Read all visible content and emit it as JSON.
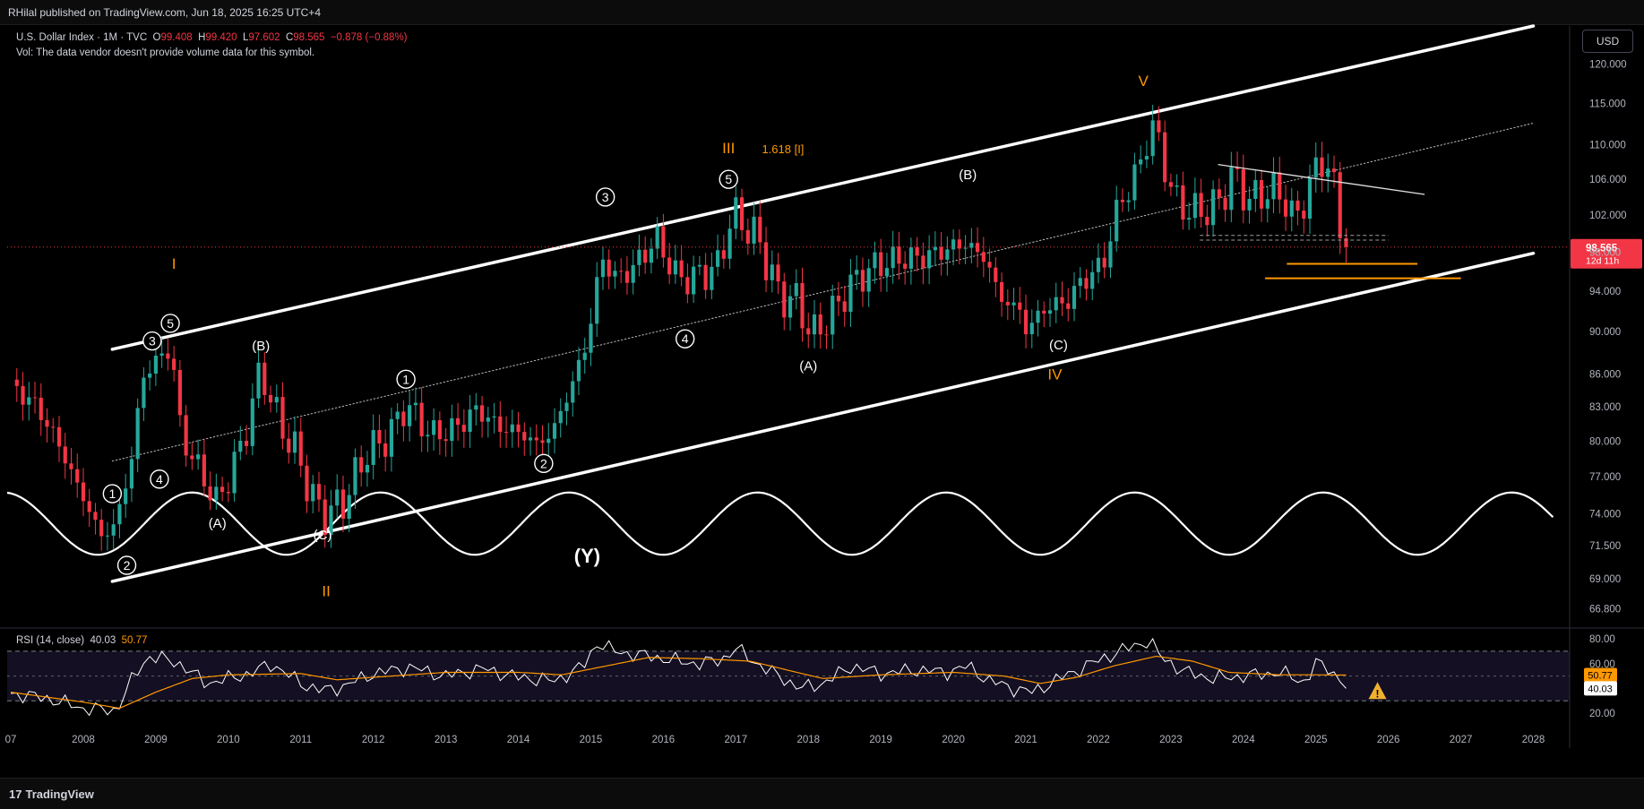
{
  "header": {
    "publisher_line": "RHilal published on TradingView.com, Jun 18, 2025 16:25 UTC+4"
  },
  "legend": {
    "symbol": "U.S. Dollar Index · 1M · TVC",
    "open_label": "O",
    "open": "99.408",
    "high_label": "H",
    "high": "99.420",
    "low_label": "L",
    "low": "97.602",
    "close_label": "C",
    "close": "98.565",
    "change": "−0.878 (−0.88%)",
    "volume_note": "Vol: The data vendor doesn't provide volume data for this symbol."
  },
  "currency_button": "USD",
  "footer": {
    "brand": "TradingView",
    "logo_text": "17"
  },
  "colors": {
    "up": "#26a69a",
    "down": "#f23645",
    "channel": "#ffffff",
    "wave_orange": "#ff9800",
    "rsi_line": "#ffffff",
    "rsi_ma": "#ff9800",
    "price_line": "#f23645"
  },
  "chart_data": [
    {
      "type": "candlestick",
      "title": "U.S. Dollar Index · 1M · TVC",
      "y_scale": "log",
      "ylim": [
        65.5,
        125
      ],
      "x_range": [
        2006.95,
        2028.5
      ],
      "x_ticks": [
        "07",
        "2008",
        "2009",
        "2010",
        "2011",
        "2012",
        "2013",
        "2014",
        "2015",
        "2016",
        "2017",
        "2018",
        "2019",
        "2020",
        "2021",
        "2022",
        "2023",
        "2024",
        "2025",
        "2026",
        "2027",
        "2028"
      ],
      "y_ticks": [
        "120.000",
        "115.000",
        "110.000",
        "106.000",
        "102.000",
        "98.000",
        "94.000",
        "90.000",
        "86.000",
        "83.000",
        "80.000",
        "77.000",
        "74.000",
        "71.500",
        "69.000",
        "66.800"
      ],
      "last_price": {
        "value": 98.565,
        "label": "98.565",
        "countdown": "12d 11h"
      },
      "channel": {
        "upper": [
          [
            2008.4,
            88.3
          ],
          [
            2028.0,
            125.0
          ]
        ],
        "middle": [
          [
            2008.4,
            78.3
          ],
          [
            2028.0,
            112.6
          ]
        ],
        "lower": [
          [
            2008.4,
            68.8
          ],
          [
            2028.0,
            97.9
          ]
        ]
      },
      "cycle": {
        "high": 75.7,
        "low": 70.8,
        "first_trough": 2008.2,
        "period": 2.6
      },
      "support_lines": [
        {
          "x": [
            2024.6,
            2026.4
          ],
          "y": 96.8
        },
        {
          "x": [
            2024.3,
            2027.0
          ],
          "y": 95.3
        }
      ],
      "dashed_levels": [
        {
          "x": [
            2023.4,
            2026.0
          ],
          "y": 99.8
        },
        {
          "x": [
            2023.4,
            2026.0
          ],
          "y": 99.3
        }
      ],
      "triangle_line": {
        "x": [
          2023.65,
          2026.5
        ],
        "y": [
          107.7,
          104.3
        ]
      },
      "wave_labels": [
        {
          "text": "I",
          "x": 2009.25,
          "y": 96.3,
          "style": "orange"
        },
        {
          "text": "II",
          "x": 2011.35,
          "y": 67.7,
          "style": "orange"
        },
        {
          "text": "III",
          "x": 2016.9,
          "y": 109.0,
          "style": "orange"
        },
        {
          "text": "1.618 [I]",
          "x": 2017.65,
          "y": 109.0,
          "style": "orange-small"
        },
        {
          "text": "IV",
          "x": 2021.4,
          "y": 85.5,
          "style": "orange"
        },
        {
          "text": "V",
          "x": 2022.62,
          "y": 117.2,
          "style": "orange"
        },
        {
          "text": "1",
          "x": 2008.4,
          "y": 75.6,
          "style": "circle"
        },
        {
          "text": "2",
          "x": 2008.6,
          "y": 70.0,
          "style": "circle"
        },
        {
          "text": "3",
          "x": 2008.95,
          "y": 89.1,
          "style": "circle"
        },
        {
          "text": "4",
          "x": 2009.05,
          "y": 76.8,
          "style": "circle"
        },
        {
          "text": "5",
          "x": 2009.2,
          "y": 90.8,
          "style": "circle"
        },
        {
          "text": "(A)",
          "x": 2009.85,
          "y": 72.9,
          "style": "white"
        },
        {
          "text": "(B)",
          "x": 2010.45,
          "y": 88.2,
          "style": "white"
        },
        {
          "text": "(C)",
          "x": 2011.3,
          "y": 72.0,
          "style": "white"
        },
        {
          "text": "1",
          "x": 2012.45,
          "y": 85.5,
          "style": "circle"
        },
        {
          "text": "2",
          "x": 2014.35,
          "y": 78.1,
          "style": "circle"
        },
        {
          "text": "3",
          "x": 2015.2,
          "y": 104.0,
          "style": "circle"
        },
        {
          "text": "4",
          "x": 2016.3,
          "y": 89.3,
          "style": "circle"
        },
        {
          "text": "5",
          "x": 2016.9,
          "y": 106.0,
          "style": "circle"
        },
        {
          "text": "(Y)",
          "x": 2014.95,
          "y": 70.2,
          "style": "white-big"
        },
        {
          "text": "(A)",
          "x": 2018.0,
          "y": 86.3,
          "style": "white"
        },
        {
          "text": "(B)",
          "x": 2020.2,
          "y": 106.0,
          "style": "white"
        },
        {
          "text": "(C)",
          "x": 2021.45,
          "y": 88.3,
          "style": "white"
        }
      ]
    },
    {
      "type": "line",
      "title": "RSI (14, close)",
      "values_label": [
        "40.03",
        "50.77"
      ],
      "ylim": [
        10,
        88
      ],
      "y_ticks": [
        "80.00",
        "60.00",
        "20.00"
      ],
      "bands": [
        70,
        30
      ],
      "midline": 50,
      "rsi_last": {
        "value": 40.03,
        "label": "40.03"
      },
      "ma_last": {
        "value": 50.77,
        "label": "50.77"
      },
      "rsi_anchors": [
        [
          2007.0,
          36
        ],
        [
          2007.5,
          32
        ],
        [
          2008.0,
          24
        ],
        [
          2008.45,
          22
        ],
        [
          2008.7,
          50
        ],
        [
          2008.9,
          66
        ],
        [
          2009.3,
          61
        ],
        [
          2009.7,
          44
        ],
        [
          2010.3,
          52
        ],
        [
          2010.6,
          60
        ],
        [
          2011.0,
          44
        ],
        [
          2011.3,
          38
        ],
        [
          2011.6,
          42
        ],
        [
          2012.0,
          52
        ],
        [
          2012.5,
          57
        ],
        [
          2013.0,
          50
        ],
        [
          2013.5,
          56
        ],
        [
          2014.0,
          49
        ],
        [
          2014.5,
          46
        ],
        [
          2014.9,
          58
        ],
        [
          2015.1,
          78
        ],
        [
          2015.3,
          70
        ],
        [
          2015.8,
          66
        ],
        [
          2016.2,
          62
        ],
        [
          2016.5,
          60
        ],
        [
          2016.8,
          63
        ],
        [
          2017.0,
          72
        ],
        [
          2017.4,
          56
        ],
        [
          2017.9,
          40
        ],
        [
          2018.2,
          44
        ],
        [
          2018.6,
          58
        ],
        [
          2019.0,
          52
        ],
        [
          2019.5,
          55
        ],
        [
          2019.9,
          53
        ],
        [
          2020.2,
          58
        ],
        [
          2020.5,
          46
        ],
        [
          2020.9,
          39
        ],
        [
          2021.1,
          37
        ],
        [
          2021.5,
          49
        ],
        [
          2021.9,
          60
        ],
        [
          2022.3,
          70
        ],
        [
          2022.7,
          79
        ],
        [
          2022.85,
          66
        ],
        [
          2023.2,
          53
        ],
        [
          2023.6,
          48
        ],
        [
          2024.0,
          50
        ],
        [
          2024.5,
          53
        ],
        [
          2024.85,
          45
        ],
        [
          2025.0,
          60
        ],
        [
          2025.2,
          56
        ],
        [
          2025.4,
          40.03
        ]
      ],
      "ma_anchors": [
        [
          2007.0,
          37
        ],
        [
          2008.0,
          29
        ],
        [
          2008.5,
          24
        ],
        [
          2009.0,
          37
        ],
        [
          2009.5,
          48
        ],
        [
          2010.0,
          51
        ],
        [
          2011.0,
          52
        ],
        [
          2011.5,
          47
        ],
        [
          2012.0,
          49
        ],
        [
          2013.0,
          53
        ],
        [
          2014.0,
          53
        ],
        [
          2014.6,
          51
        ],
        [
          2015.2,
          58
        ],
        [
          2015.8,
          65
        ],
        [
          2016.5,
          64
        ],
        [
          2017.2,
          62
        ],
        [
          2017.7,
          55
        ],
        [
          2018.2,
          48
        ],
        [
          2019.0,
          51
        ],
        [
          2020.0,
          53
        ],
        [
          2020.7,
          50
        ],
        [
          2021.2,
          44
        ],
        [
          2021.7,
          49
        ],
        [
          2022.2,
          58
        ],
        [
          2022.8,
          66
        ],
        [
          2023.3,
          62
        ],
        [
          2023.8,
          53
        ],
        [
          2024.5,
          51
        ],
        [
          2025.0,
          51
        ],
        [
          2025.4,
          50.77
        ]
      ]
    }
  ],
  "rsi_warning_icon": "warning-icon"
}
